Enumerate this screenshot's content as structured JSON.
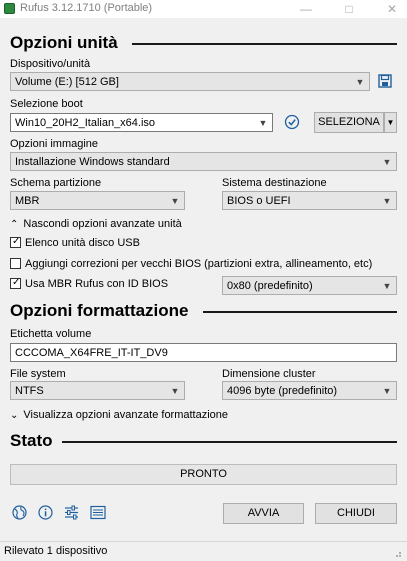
{
  "window": {
    "title": "Rufus 3.12.1710 (Portable)"
  },
  "drive": {
    "heading": "Opzioni unità",
    "device_label": "Dispositivo/unità",
    "device_value": "Volume (E:) [512 GB]",
    "boot_label": "Selezione boot",
    "boot_value": "Win10_20H2_Italian_x64.iso",
    "select_button": "SELEZIONA",
    "image_option_label": "Opzioni immagine",
    "image_option_value": "Installazione Windows standard",
    "partition_label": "Schema partizione",
    "partition_value": "MBR",
    "target_label": "Sistema destinazione",
    "target_value": "BIOS o UEFI",
    "advanced_toggle": "Nascondi opzioni avanzate unità",
    "list_usb": {
      "label": "Elenco unità disco USB",
      "checked": true
    },
    "old_bios_fixes": {
      "label": "Aggiungi correzioni per vecchi BIOS (partizioni extra, allineamento, etc)",
      "checked": false
    },
    "rufus_mbr": {
      "label": "Usa MBR Rufus con ID BIOS",
      "checked": true
    },
    "bios_id_value": "0x80 (predefinito)"
  },
  "format": {
    "heading": "Opzioni formattazione",
    "volume_label": "Etichetta volume",
    "volume_value": "CCCOMA_X64FRE_IT-IT_DV9",
    "filesystem_label": "File system",
    "filesystem_value": "NTFS",
    "cluster_label": "Dimensione cluster",
    "cluster_value": "4096 byte (predefinito)",
    "advanced_toggle": "Visualizza opzioni avanzate formattazione"
  },
  "status": {
    "heading": "Stato",
    "progress_text": "PRONTO",
    "progress_fraction": 0
  },
  "actions": {
    "start": "AVVIA",
    "close": "CHIUDI"
  },
  "statusbar": {
    "text": "Rilevato 1 dispositivo"
  },
  "icons": {
    "save": "save-icon",
    "verify": "check-circle-icon",
    "language": "globe-icon",
    "about": "info-icon",
    "settings": "sliders-icon",
    "log": "log-icon"
  },
  "colors": {
    "accent_icon": "#1f5f9e",
    "progress_bg": "#e6e6e6"
  }
}
